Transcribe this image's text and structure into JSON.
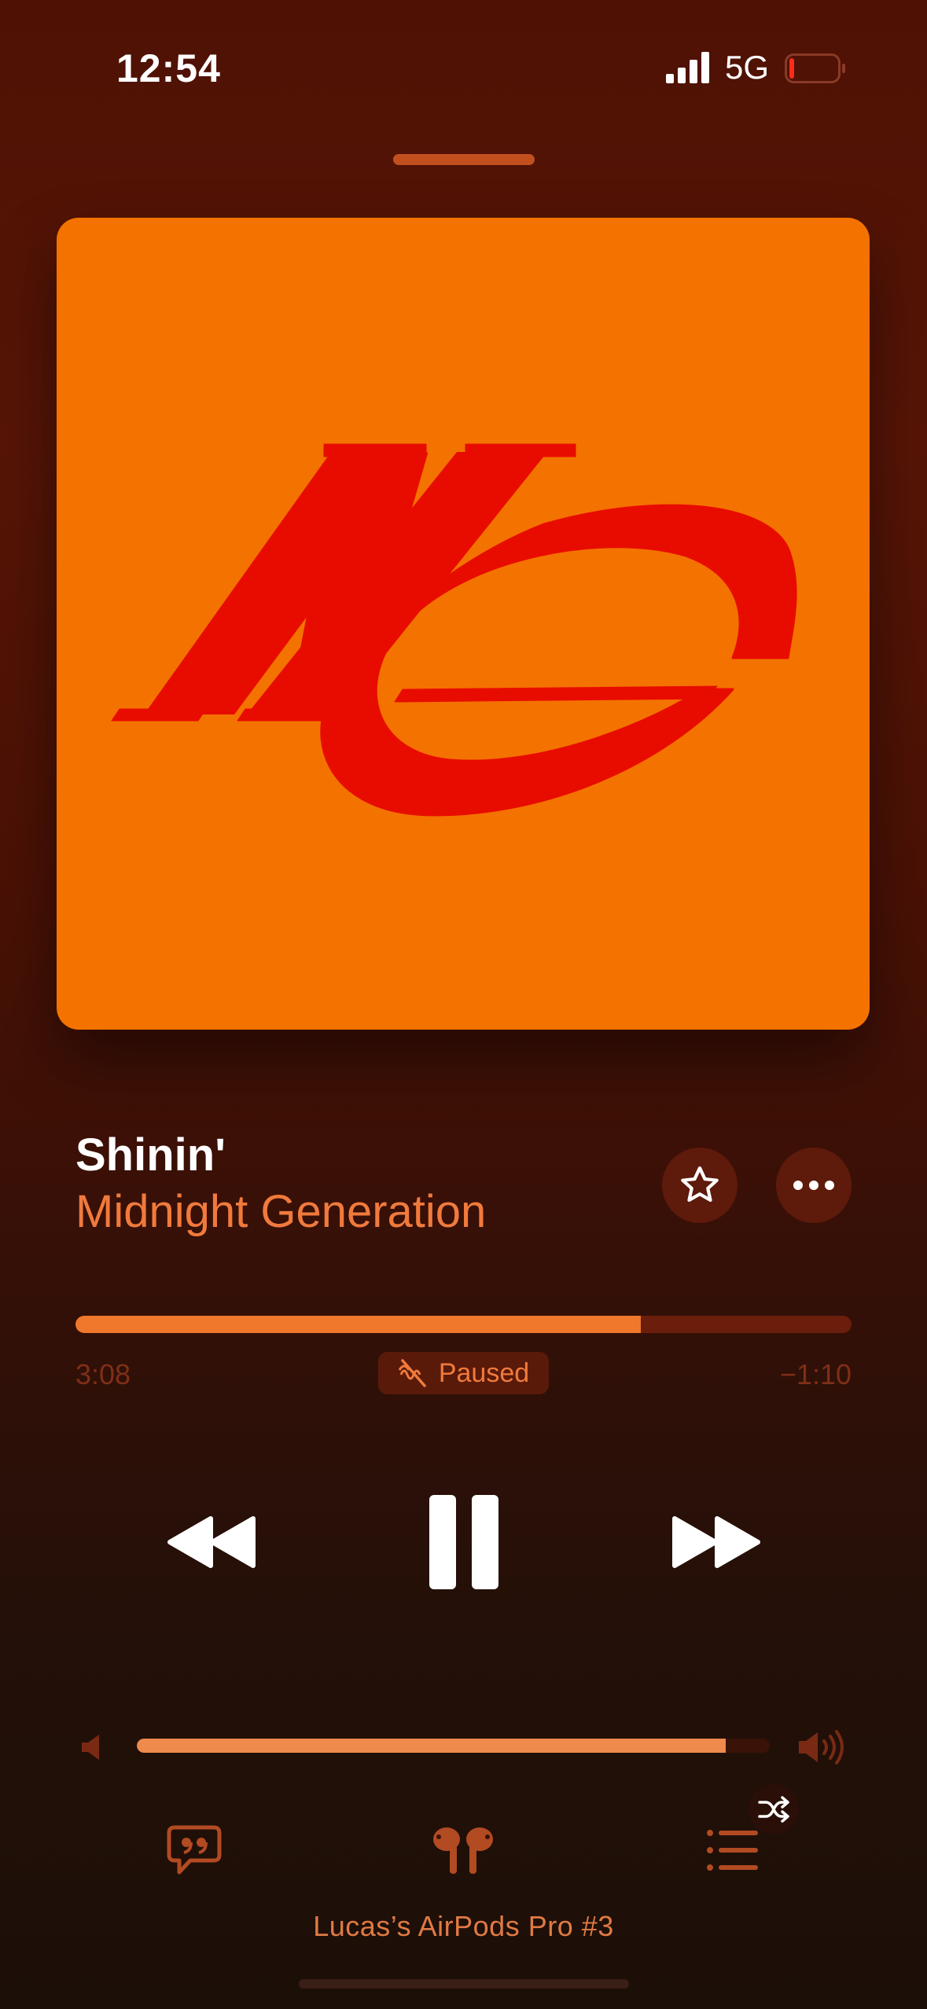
{
  "status_bar": {
    "time": "12:54",
    "network": "5G",
    "battery_level": 0.1,
    "signal_bars": 4
  },
  "artwork": {
    "monogram": "MG",
    "background_color": "#f47200",
    "monogram_color": "#e80c00"
  },
  "track": {
    "title": "Shinin'",
    "artist": "Midnight Generation"
  },
  "progress": {
    "elapsed": "3:08",
    "remaining": "−1:10",
    "fraction": 0.728
  },
  "playback_status": {
    "label": "Paused",
    "icon": "lossless-paused-icon"
  },
  "controls": {
    "previous": "backward-icon",
    "play_pause": "pause-icon",
    "next": "forward-icon"
  },
  "volume": {
    "level": 0.93
  },
  "bottom_bar": {
    "lyrics_icon": "quote-bubble-icon",
    "route_icon": "airpods-icon",
    "queue_icon": "list-icon",
    "shuffle_icon": "shuffle-icon",
    "device_name": "Lucas’s AirPods Pro #3"
  },
  "colors": {
    "accent": "#f0782c",
    "background_top": "#4e1204",
    "background_bottom": "#1c0f08"
  }
}
